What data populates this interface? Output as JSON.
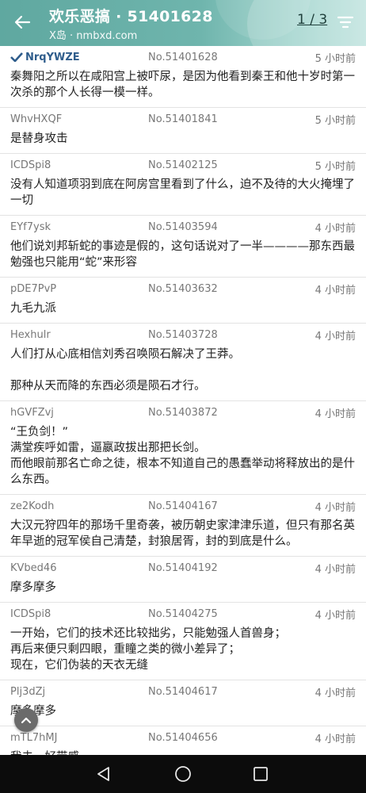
{
  "header": {
    "title": "欢乐恶搞 · 51401628",
    "subtitle": "X岛 · nmbxd.com",
    "pager": "1 / 3"
  },
  "posts": [
    {
      "uid": "NrqYWZE",
      "no": "No.51401628",
      "time": "5 小时前",
      "text": "秦舞阳之所以在咸阳宫上被吓尿，是因为他看到秦王和他十岁时第一次杀的那个人长得一模一样。"
    },
    {
      "uid": "WhvHXQF",
      "no": "No.51401841",
      "time": "5 小时前",
      "text": "是替身攻击"
    },
    {
      "uid": "ICDSpi8",
      "no": "No.51402125",
      "time": "5 小时前",
      "text": "没有人知道项羽到底在阿房宫里看到了什么，迫不及待的大火掩埋了一切"
    },
    {
      "uid": "EYf7ysk",
      "no": "No.51403594",
      "time": "4 小时前",
      "text": "他们说刘邦斩蛇的事迹是假的，这句话说对了一半————那东西最勉强也只能用“蛇”来形容"
    },
    {
      "uid": "pDE7PvP",
      "no": "No.51403632",
      "time": "4 小时前",
      "text": "九毛九派"
    },
    {
      "uid": "Hexhulr",
      "no": "No.51403728",
      "time": "4 小时前",
      "text": "人们打从心底相信刘秀召唤陨石解决了王莽。\n\n那种从天而降的东西必须是陨石才行。"
    },
    {
      "uid": "hGVFZvj",
      "no": "No.51403872",
      "time": "4 小时前",
      "text": "“王负剑！”\n满堂疾呼如雷，逼嬴政拔出那把长剑。\n而他眼前那名亡命之徒，根本不知道自己的愚蠢举动将释放出的是什么东西。"
    },
    {
      "uid": "ze2Kodh",
      "no": "No.51404167",
      "time": "4 小时前",
      "text": "大汉元狩四年的那场千里奇袭，被历朝史家津津乐道，但只有那名英年早逝的冠军侯自己清楚，封狼居胥，封的到底是什么。"
    },
    {
      "uid": "KVbed46",
      "no": "No.51404192",
      "time": "4 小时前",
      "text": "摩多摩多"
    },
    {
      "uid": "ICDSpi8",
      "no": "No.51404275",
      "time": "4 小时前",
      "text": "一开始，它们的技术还比较拙劣，只能勉强人首兽身；\n再后来便只剩四眼，重瞳之类的微小差异了；\n现在，它们伪装的天衣无缝"
    },
    {
      "uid": "Plj3dZj",
      "no": "No.51404617",
      "time": "4 小时前",
      "text": "摩多摩多"
    },
    {
      "uid": "mTL7hMJ",
      "no": "No.51404656",
      "time": "4 小时前",
      "text": "我去，好带感"
    }
  ],
  "colors": {
    "header": "#6fb5ad",
    "op_uid": "#2f5d8c",
    "navbar": "#0c0c0c"
  }
}
